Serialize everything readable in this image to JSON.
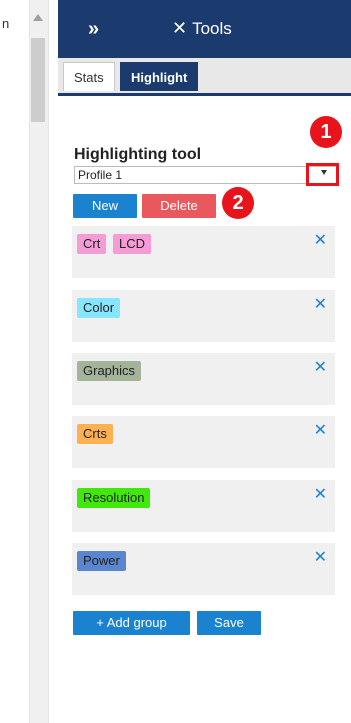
{
  "left_window": {
    "fragment_text": "n"
  },
  "topbar": {
    "collapse_glyph": "»",
    "title": "Tools",
    "title_icon": "✕"
  },
  "tabs": [
    {
      "label": "Stats",
      "active": false
    },
    {
      "label": "Highlight",
      "active": true
    }
  ],
  "tool": {
    "title": "Highlighting tool",
    "profile_value": "Profile 1",
    "new_label": "New",
    "delete_label": "Delete"
  },
  "annotations": {
    "one": "1",
    "two": "2"
  },
  "groups": [
    {
      "tags": [
        {
          "label": "Crt",
          "color": "#f59bd6"
        },
        {
          "label": "LCD",
          "color": "#f59bd6"
        }
      ]
    },
    {
      "tags": [
        {
          "label": "Color",
          "color": "#86e6ff"
        }
      ]
    },
    {
      "tags": [
        {
          "label": "Graphics",
          "color": "#a4b49b"
        }
      ]
    },
    {
      "tags": [
        {
          "label": "Crts",
          "color": "#ffb050"
        }
      ]
    },
    {
      "tags": [
        {
          "label": "Resolution",
          "color": "#40e80c"
        }
      ]
    },
    {
      "tags": [
        {
          "label": "Power",
          "color": "#5a86cf"
        }
      ]
    }
  ],
  "remove_glyph": "✕",
  "footer": {
    "add_group_label": "+ Add group",
    "save_label": "Save"
  },
  "colors": {
    "navy": "#1b3b6e",
    "blue": "#1b82d0",
    "red": "#e8141c",
    "delete": "#e8585c"
  }
}
